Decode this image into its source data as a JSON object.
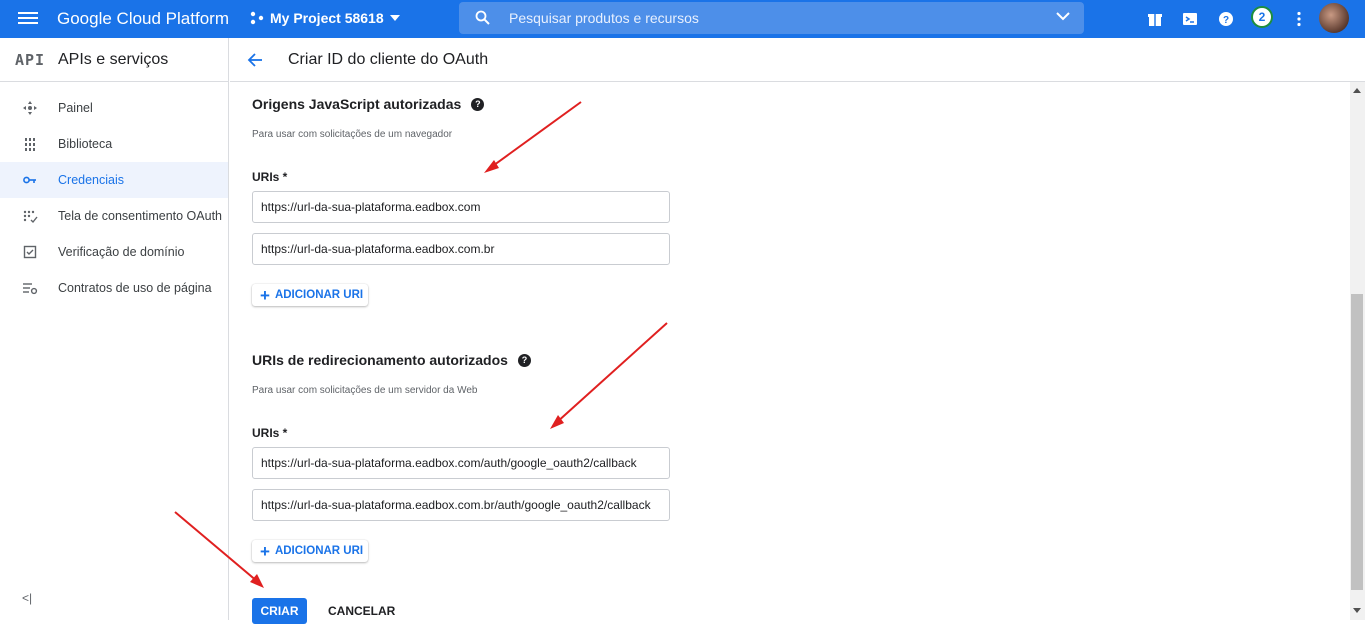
{
  "topbar": {
    "brand": "Google Cloud Platform",
    "project": "My Project 58618",
    "search_placeholder": "Pesquisar produtos e recursos",
    "notifications_count": "2"
  },
  "sidebar": {
    "api_logo": "API",
    "title": "APIs e serviços",
    "items": [
      {
        "label": "Painel",
        "icon": "dashboard-icon"
      },
      {
        "label": "Biblioteca",
        "icon": "library-icon"
      },
      {
        "label": "Credenciais",
        "icon": "key-icon"
      },
      {
        "label": "Tela de consentimento OAuth",
        "icon": "consent-icon"
      },
      {
        "label": "Verificação de domínio",
        "icon": "checkbox-icon"
      },
      {
        "label": "Contratos de uso de página",
        "icon": "settings-list-icon"
      }
    ],
    "active_item": "Credenciais",
    "collapse_label": "<|"
  },
  "page": {
    "title": "Criar ID do cliente do OAuth"
  },
  "js_origins": {
    "title": "Origens JavaScript autorizadas",
    "description": "Para usar com solicitações de um navegador",
    "uris_label": "URIs *",
    "uris": [
      "https://url-da-sua-plataforma.eadbox.com",
      "https://url-da-sua-plataforma.eadbox.com.br"
    ],
    "add_label": "ADICIONAR URI"
  },
  "redirects": {
    "title": "URIs de redirecionamento autorizados",
    "description": "Para usar com solicitações de um servidor da Web",
    "uris_label": "URIs *",
    "uris": [
      "https://url-da-sua-plataforma.eadbox.com/auth/google_oauth2/callback",
      "https://url-da-sua-plataforma.eadbox.com.br/auth/google_oauth2/callback"
    ],
    "add_label": "ADICIONAR URI"
  },
  "actions": {
    "create_label": "CRIAR",
    "cancel_label": "CANCELAR"
  },
  "colors": {
    "primary": "#1a73e8",
    "annotation_arrow": "#e02020"
  }
}
